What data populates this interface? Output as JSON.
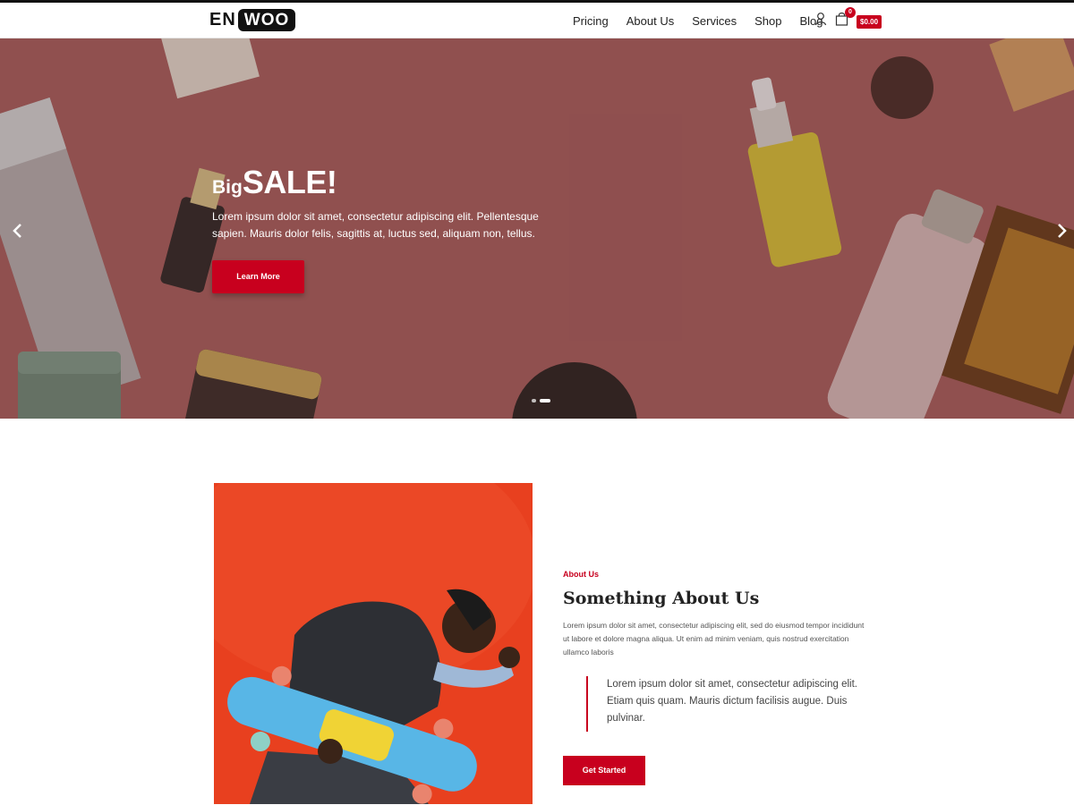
{
  "header": {
    "logo_left": "EN",
    "logo_right": "WOO",
    "nav": [
      {
        "label": "Pricing"
      },
      {
        "label": "About Us"
      },
      {
        "label": "Services"
      },
      {
        "label": "Shop"
      },
      {
        "label": "Blog"
      }
    ],
    "account_icon": "user-icon",
    "cart_icon": "shopping-bag-icon",
    "cart_count": "0",
    "cart_total": "$0.00"
  },
  "hero": {
    "title_small": "Big",
    "title_big": "SALE!",
    "text": "Lorem ipsum dolor sit amet, consectetur adipiscing elit. Pellentesque sapien. Mauris dolor felis, sagittis at, luctus sed, aliquam non, tellus.",
    "button": "Learn More",
    "prev_icon": "chevron-left-icon",
    "next_icon": "chevron-right-icon",
    "slides": 2,
    "active_slide": 2
  },
  "about": {
    "kicker": "About Us",
    "title": "Something About Us",
    "text": "Lorem ipsum dolor sit amet, consectetur adipiscing elit, sed do eiusmod tempor incididunt ut labore et dolore magna aliqua. Ut enim ad minim veniam, quis nostrud exercitation ullamco laboris",
    "quote": "Lorem ipsum dolor sit amet, consectetur adipiscing elit. Etiam quis quam. Mauris dictum facilisis augue. Duis pulvinar.",
    "button": "Get Started"
  },
  "colors": {
    "accent": "#c8001e",
    "hero_bg": "#9c5a5a",
    "about_bg": "#ea3d23"
  }
}
